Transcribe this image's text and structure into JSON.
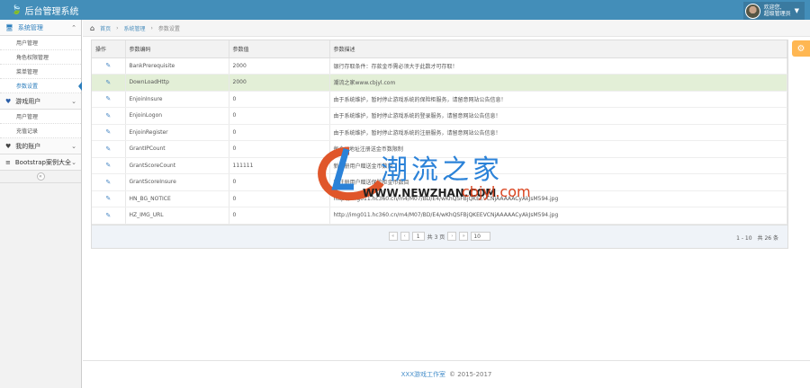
{
  "header": {
    "title": "后台管理系统",
    "user_greeting": "欢迎您,",
    "user_name": "超级管理员"
  },
  "sidebar": {
    "groups": [
      {
        "label": "系统管理",
        "icon": "desktop-icon",
        "items": [
          "用户管理",
          "角色权限管理",
          "菜单管理",
          "参数设置"
        ]
      },
      {
        "label": "游戏用户",
        "icon": "heart-icon",
        "items": [
          "用户管理",
          "充值记录"
        ]
      },
      {
        "label": "我的账户",
        "icon": "heart-icon",
        "items": []
      },
      {
        "label": "Bootstrap案例大全",
        "icon": "list-icon",
        "items": []
      }
    ],
    "active_item": "参数设置"
  },
  "breadcrumb": {
    "home": "首页",
    "section": "系统管理",
    "current": "参数设置"
  },
  "table": {
    "columns": [
      "操作",
      "参数编码",
      "参数值",
      "参数描述"
    ],
    "rows": [
      {
        "code": "BankPrerequisite",
        "value": "2000",
        "desc": "银行存取条件：存款金币需必须大于此数才可存取！"
      },
      {
        "code": "DownLoadHttp",
        "value": "2000",
        "desc": "潮流之家www.cbjyl.com"
      },
      {
        "code": "EnjoinInsure",
        "value": "0",
        "desc": "由于系统维护，暂时停止游戏系统的保险柜服务，请留意网站公告信息！"
      },
      {
        "code": "EnjoinLogon",
        "value": "0",
        "desc": "由于系统维护，暂时停止游戏系统的登录服务，请留意网站公告信息！"
      },
      {
        "code": "EnjoinRegister",
        "value": "0",
        "desc": "由于系统维护，暂时停止游戏系统的注册服务，请留意网站公告信息！"
      },
      {
        "code": "GrantIPCount",
        "value": "0",
        "desc": "每个IP地址注册送金币数限制"
      },
      {
        "code": "GrantScoreCount",
        "value": "111111",
        "desc": "新注册用户赠送金币数目"
      },
      {
        "code": "GrantScoreInsure",
        "value": "0",
        "desc": "新注册用户赠送保险柜金币数目"
      },
      {
        "code": "HN_BG_NOTICE",
        "value": "0",
        "desc": "http://img011.hc360.cn/m4/M07/BD/E4/wKhQSFBjQKEEVCNjAAAAACyAkJsM594.jpg"
      },
      {
        "code": "HZ_IMG_URL",
        "value": "0",
        "desc": "http://img011.hc360.cn/m4/M07/BD/E4/wKhQSFBjQKEEVCNjAAAAACyAkJsM594.jpg"
      }
    ],
    "highlight_row": 1
  },
  "pager": {
    "page": "1",
    "total_pages_text": "共 3 页",
    "page_size": "10",
    "info": "1 - 10　共 26 条"
  },
  "footer": {
    "studio": "XXX游戏工作室",
    "copyright": "© 2015-2017"
  },
  "watermark": {
    "cn": "潮流之家",
    "url": "WWW.NEWZHAN.COM",
    "url2": "cbjyl.com"
  }
}
